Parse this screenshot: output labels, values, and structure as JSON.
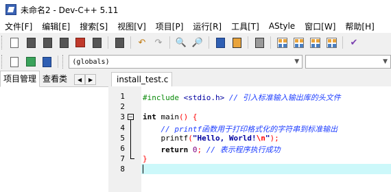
{
  "window": {
    "title": "未命名2 - Dev-C++ 5.11"
  },
  "menu": [
    {
      "label": "文件[F]"
    },
    {
      "label": "编辑[E]"
    },
    {
      "label": "搜索[S]"
    },
    {
      "label": "视图[V]"
    },
    {
      "label": "项目[P]"
    },
    {
      "label": "运行[R]"
    },
    {
      "label": "工具[T]"
    },
    {
      "label": "AStyle"
    },
    {
      "label": "窗口[W]"
    },
    {
      "label": "帮助[H]"
    }
  ],
  "toolbar2": {
    "scope_combo_value": "(globals)"
  },
  "left_panel": {
    "tabs": [
      {
        "label": "项目管理"
      },
      {
        "label": "查看类"
      }
    ]
  },
  "editor": {
    "tab_label": "install_test.c",
    "lines": [
      {
        "num": "1",
        "segments": [
          {
            "t": "#include ",
            "c": "c-pre"
          },
          {
            "t": "<stdio.h>",
            "c": "c-inc"
          },
          {
            "t": " // 引入标准输入输出库的头文件",
            "c": "c-cmt"
          }
        ]
      },
      {
        "num": "2",
        "segments": []
      },
      {
        "num": "3",
        "segments": [
          {
            "t": "int",
            "c": "c-kw"
          },
          {
            "t": " main",
            "c": ""
          },
          {
            "t": "()",
            "c": "c-br"
          },
          {
            "t": " ",
            "c": ""
          },
          {
            "t": "{",
            "c": "c-br"
          }
        ]
      },
      {
        "num": "4",
        "segments": [
          {
            "t": "    // printf函数用于打印格式化的字符串到标准输出",
            "c": "c-cmt"
          }
        ]
      },
      {
        "num": "5",
        "segments": [
          {
            "t": "    printf",
            "c": ""
          },
          {
            "t": "(",
            "c": "c-br"
          },
          {
            "t": "\"Hello, World!",
            "c": "c-str"
          },
          {
            "t": "\\n",
            "c": "c-esc"
          },
          {
            "t": "\"",
            "c": "c-str"
          },
          {
            "t": ");",
            "c": "c-br"
          }
        ]
      },
      {
        "num": "6",
        "segments": [
          {
            "t": "    ",
            "c": ""
          },
          {
            "t": "return",
            "c": "c-kw"
          },
          {
            "t": " ",
            "c": ""
          },
          {
            "t": "0",
            "c": "c-num"
          },
          {
            "t": ";",
            "c": "c-br"
          },
          {
            "t": " // 表示程序执行成功",
            "c": "c-cmt"
          }
        ]
      },
      {
        "num": "7",
        "segments": [
          {
            "t": "}",
            "c": "c-br"
          }
        ]
      },
      {
        "num": "8",
        "segments": []
      }
    ],
    "current_line": "8"
  },
  "icons": {
    "toolbar1": [
      "new-file-icon",
      "open-file-icon",
      "save-icon",
      "save-all-icon",
      "close-file-icon",
      "close-all-icon",
      "print-icon",
      "undo-icon",
      "redo-icon",
      "find-icon",
      "replace-icon",
      "indent-icon",
      "unindent-icon",
      "bookmark-icon",
      "compile-icon",
      "run-icon",
      "compile-run-icon",
      "rebuild-icon",
      "debug-icon"
    ],
    "toolbar2": [
      "new-project-icon",
      "add-to-project-icon",
      "remove-from-project-icon"
    ]
  }
}
